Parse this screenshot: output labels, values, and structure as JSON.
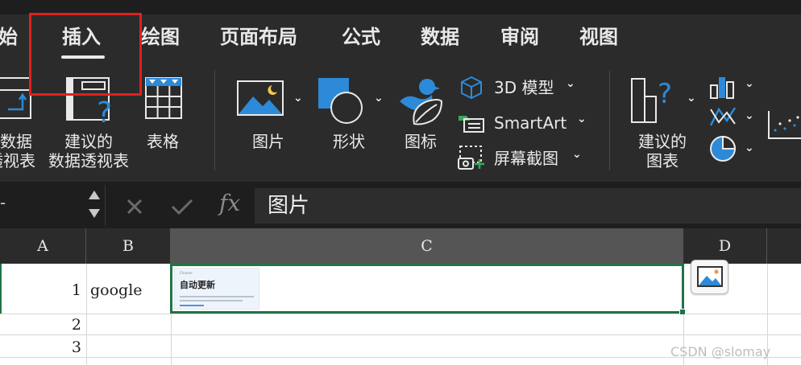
{
  "tabs": {
    "home": "开始",
    "insert": "插入",
    "draw": "绘图",
    "page_layout": "页面布局",
    "formulas": "公式",
    "data": "数据",
    "review": "审阅",
    "view": "视图"
  },
  "ribbon": {
    "pivot_table_line1": "数据",
    "pivot_table_line2": "透视表",
    "recommended_pivot_line1": "建议的",
    "recommended_pivot_line2": "数据透视表",
    "table": "表格",
    "pictures": "图片",
    "shapes": "形状",
    "icons": "图标",
    "models_3d": "3D 模型",
    "smartart": "SmartArt",
    "screenshot": "屏幕截图",
    "recommended_charts_line1": "建议的",
    "recommended_charts_line2": "图表"
  },
  "formula_bar": {
    "name_box": "-",
    "fx": "fx",
    "content": "图片"
  },
  "sheet": {
    "columns": [
      "A",
      "B",
      "C",
      "D"
    ],
    "rows": [
      {
        "number": "1",
        "b": "google"
      },
      {
        "number": "2",
        "b": ""
      },
      {
        "number": "3",
        "b": ""
      }
    ],
    "image_thumbnail": {
      "title": "自动更新",
      "caption": "Chrome 每四周推出一个新版本"
    }
  },
  "watermark": "CSDN @slomay",
  "colors": {
    "ribbon_bg": "#2b2b2b",
    "selection": "#217346",
    "highlight": "#e02020",
    "icon_blue": "#2d8ad8"
  }
}
